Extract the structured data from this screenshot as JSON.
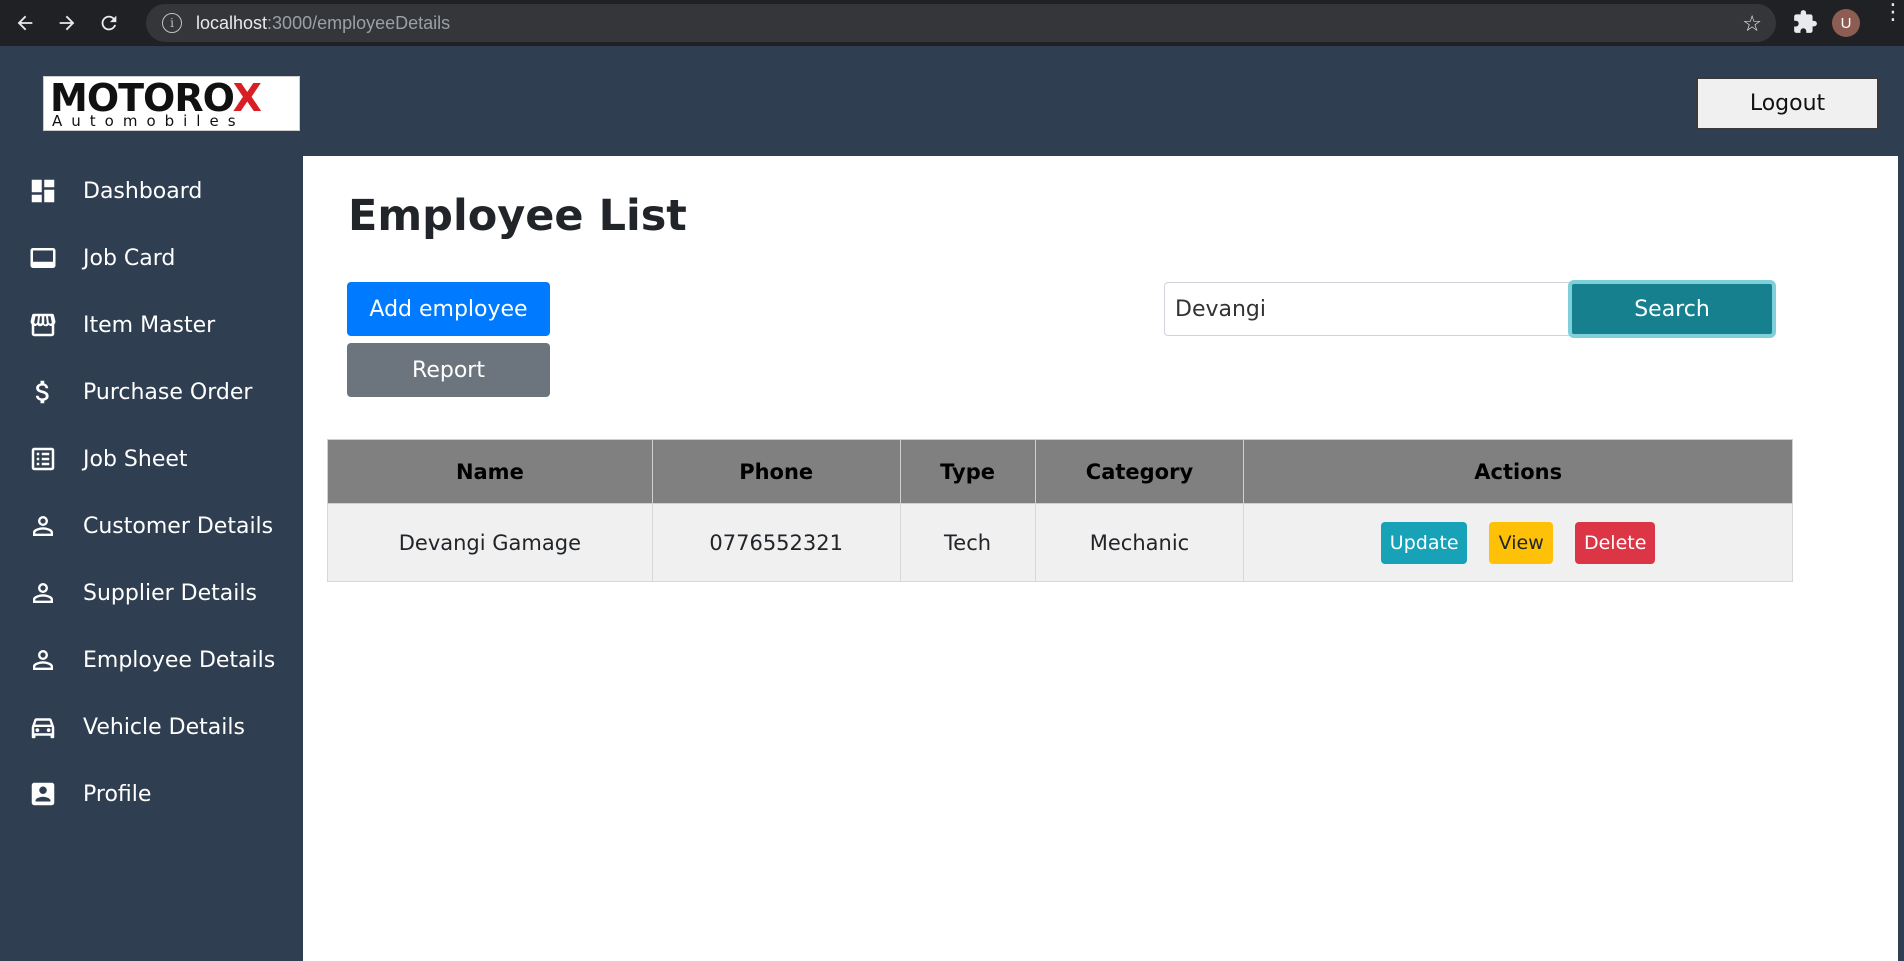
{
  "browser": {
    "url_host": "localhost",
    "url_path": ":3000/employeeDetails",
    "avatar_letter": "U"
  },
  "header": {
    "logo_word_a": "MOTORO",
    "logo_word_x": "X",
    "logo_sub": "Automobiles",
    "logout_label": "Logout"
  },
  "sidebar": {
    "items": [
      {
        "label": "Dashboard",
        "icon": "dashboard-icon"
      },
      {
        "label": "Job Card",
        "icon": "card-icon"
      },
      {
        "label": "Item Master",
        "icon": "store-icon"
      },
      {
        "label": "Purchase Order",
        "icon": "dollar-icon"
      },
      {
        "label": "Job Sheet",
        "icon": "list-icon"
      },
      {
        "label": "Customer Details",
        "icon": "person-icon"
      },
      {
        "label": "Supplier Details",
        "icon": "person-icon"
      },
      {
        "label": "Employee Details",
        "icon": "person-icon"
      },
      {
        "label": "Vehicle Details",
        "icon": "car-icon"
      },
      {
        "label": "Profile",
        "icon": "profile-icon"
      }
    ]
  },
  "main": {
    "title": "Employee List",
    "add_label": "Add employee",
    "report_label": "Report",
    "search_value": "Devangi",
    "search_label": "Search",
    "table": {
      "headers": [
        "Name",
        "Phone",
        "Type",
        "Category",
        "Actions"
      ],
      "rows": [
        {
          "name": "Devangi Gamage",
          "phone": "0776552321",
          "type": "Tech",
          "category": "Mechanic"
        }
      ],
      "actions": {
        "update": "Update",
        "view": "View",
        "delete": "Delete"
      }
    }
  },
  "colors": {
    "sidebar_bg": "#2f3e50",
    "primary": "#007bff",
    "secondary": "#6c757d",
    "search": "#17808f",
    "update": "#17a2b8",
    "view": "#ffc107",
    "delete": "#dc3545"
  }
}
